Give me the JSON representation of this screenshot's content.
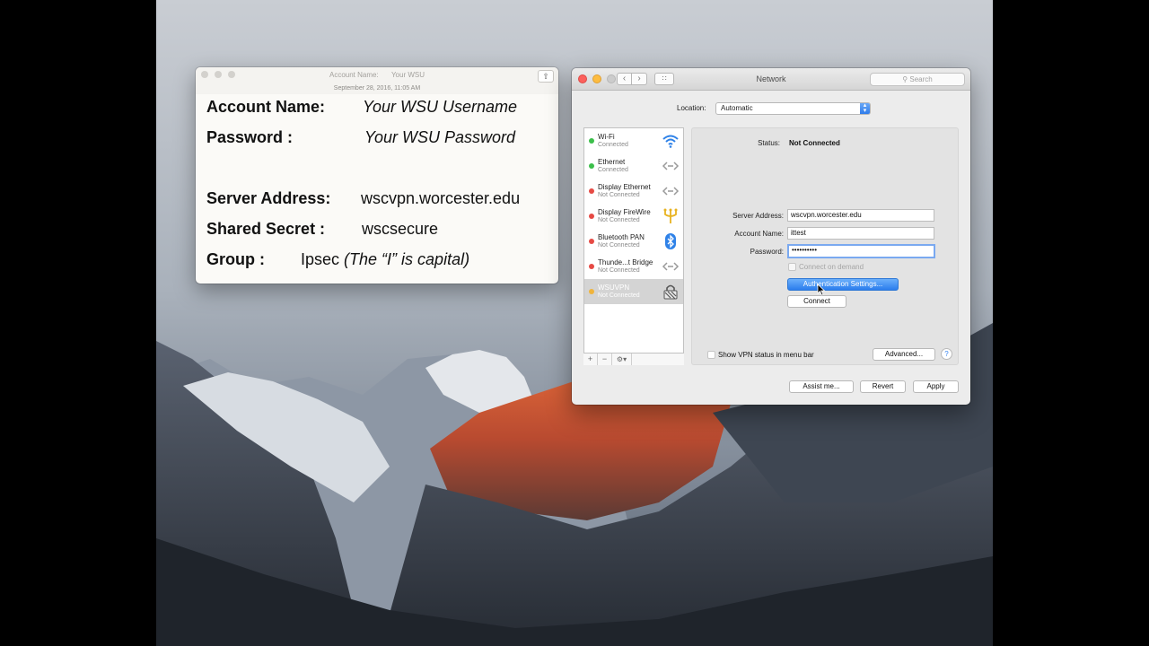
{
  "notes_window": {
    "title_label": "Account Name:",
    "title_value": "Your WSU",
    "date": "September 28, 2016, 11:05 AM",
    "share_icon": "share-icon",
    "rows": [
      {
        "label": "Account Name:",
        "value": "Your WSU Username",
        "italic": true
      },
      {
        "label": "Password :",
        "value": "Your WSU Password",
        "italic": true
      },
      {
        "label": "Server Address:",
        "value": "wscvpn.worcester.edu"
      },
      {
        "label": "Shared Secret :",
        "value": "wscsecure"
      },
      {
        "label": "Group :",
        "value": "Ipsec",
        "note": "(The “I” is capital)"
      }
    ]
  },
  "network_window": {
    "title": "Network",
    "search_placeholder": "Search",
    "nav_back": "‹",
    "nav_forward": "›",
    "grid_icon": "∷",
    "location_label": "Location:",
    "location_value": "Automatic",
    "services": [
      {
        "name": "Wi-Fi",
        "status": "Connected",
        "dot": "#3cbf4a",
        "icon": "wifi-icon",
        "glyph": "◠"
      },
      {
        "name": "Ethernet",
        "status": "Connected",
        "dot": "#3cbf4a",
        "icon": "ethernet-icon",
        "glyph": "‹··›"
      },
      {
        "name": "Display Ethernet",
        "status": "Not Connected",
        "dot": "#e64a44",
        "icon": "ethernet-icon",
        "glyph": "‹··›"
      },
      {
        "name": "Display FireWire",
        "status": "Not Connected",
        "dot": "#e64a44",
        "icon": "firewire-icon",
        "glyph": "Ψ"
      },
      {
        "name": "Bluetooth PAN",
        "status": "Not Connected",
        "dot": "#e64a44",
        "icon": "bluetooth-icon",
        "glyph": "ʙ"
      },
      {
        "name": "Thunde...t Bridge",
        "status": "Not Connected",
        "dot": "#e64a44",
        "icon": "thunderbolt-bridge-icon",
        "glyph": "‹··›"
      },
      {
        "name": "WSUVPN",
        "status": "Not Connected",
        "dot": "#f0b43c",
        "icon": "vpn-lock-icon",
        "glyph": "▨"
      }
    ],
    "list_add": "+",
    "list_remove": "−",
    "list_gear": "⚙▾",
    "status_label": "Status:",
    "status_value": "Not Connected",
    "server_label": "Server Address:",
    "server_value": "wscvpn.worcester.edu",
    "account_label": "Account Name:",
    "account_value": "ittest",
    "password_label": "Password:",
    "password_value": "••••••••••",
    "connect_on_demand": "Connect on demand",
    "auth_settings": "Authentication Settings...",
    "connect": "Connect",
    "show_vpn": "Show VPN status in menu bar",
    "advanced": "Advanced...",
    "help": "?",
    "assist": "Assist me...",
    "revert": "Revert",
    "apply": "Apply"
  }
}
